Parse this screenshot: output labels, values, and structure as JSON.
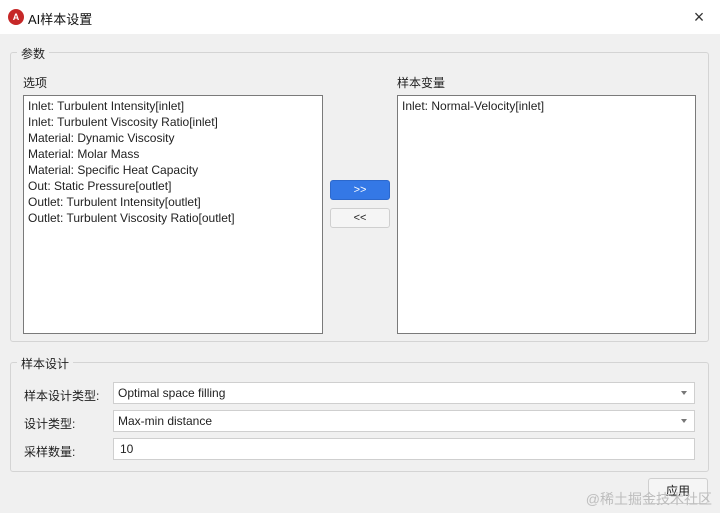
{
  "window": {
    "title": "AI样本设置",
    "icon": "app-logo-icon",
    "close": "×"
  },
  "params": {
    "group_title": "参数",
    "options_label": "选项",
    "options": [
      "Inlet: Turbulent Intensity[inlet]",
      "Inlet: Turbulent Viscosity Ratio[inlet]",
      "Material: Dynamic Viscosity",
      "Material: Molar Mass",
      "Material: Specific Heat Capacity",
      "Out: Static Pressure[outlet]",
      "Outlet: Turbulent Intensity[outlet]",
      "Outlet: Turbulent Viscosity Ratio[outlet]"
    ],
    "add_label": ">>",
    "remove_label": "<<",
    "variables_label": "样本变量",
    "variables": [
      "Inlet: Normal-Velocity[inlet]"
    ]
  },
  "design": {
    "group_title": "样本设计",
    "sample_design_type_label": "样本设计类型:",
    "sample_design_type_value": "Optimal space filling",
    "design_type_label": "设计类型:",
    "design_type_value": "Max-min distance",
    "sample_count_label": "采样数量:",
    "sample_count_value": "10"
  },
  "apply_label": "应用",
  "watermark": "@稀土掘金技术社区",
  "colors": {
    "accent": "#3478e6",
    "icon_red": "#c62828",
    "panel_bg": "#f0f0f0"
  }
}
